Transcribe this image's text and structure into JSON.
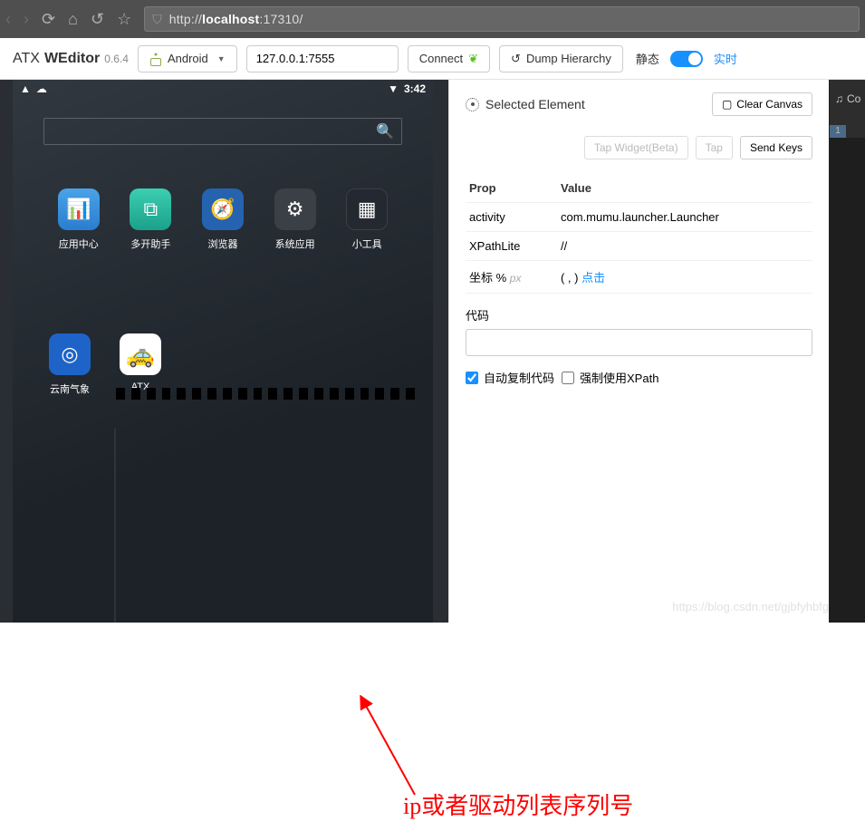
{
  "browser": {
    "url_prefix": "http://",
    "url_host": "localhost",
    "url_port": ":17310/"
  },
  "toolbar": {
    "brand_atx": "ATX",
    "brand_we": "WEditor",
    "version": "0.6.4",
    "platform_label": "Android",
    "ip_value": "127.0.0.1:7555",
    "connect_label": "Connect",
    "dump_label": "Dump Hierarchy",
    "static_label": "静态",
    "realtime_label": "实时"
  },
  "phone": {
    "time": "3:42",
    "apps_row1": [
      {
        "label": "应用中心",
        "icon": "📊",
        "cls": "ic-blue"
      },
      {
        "label": "多开助手",
        "icon": "⧉",
        "cls": "ic-teal"
      },
      {
        "label": "浏览器",
        "icon": "🧭",
        "cls": "ic-compass"
      },
      {
        "label": "系统应用",
        "icon": "⚙",
        "cls": "ic-sys"
      },
      {
        "label": "小工具",
        "icon": "▦",
        "cls": "ic-tool"
      }
    ],
    "apps_row2": [
      {
        "label": "云南气象",
        "icon": "◎",
        "cls": "ic-weather"
      },
      {
        "label": "ATX",
        "icon": "🚕",
        "cls": "ic-atx"
      }
    ]
  },
  "panel": {
    "title": "Selected Element",
    "clear_btn": "Clear Canvas",
    "tap_widget_btn": "Tap Widget(Beta)",
    "tap_btn": "Tap",
    "send_keys_btn": "Send Keys",
    "header_prop": "Prop",
    "header_value": "Value",
    "rows": [
      {
        "prop": "activity",
        "value": "com.mumu.launcher.Launcher"
      },
      {
        "prop": "XPathLite",
        "value": "//"
      }
    ],
    "coord_label": "坐标 %",
    "coord_unit": "px",
    "coord_value": "( , ) ",
    "coord_link": "点击",
    "code_label": "代码",
    "auto_copy_label": "自动复制代码",
    "force_xpath_label": "强制使用XPath"
  },
  "side": {
    "tab": "Co",
    "line": "1"
  },
  "annotation": {
    "text": "ip或者驱动列表序列号"
  },
  "watermark": "https://blog.csdn.net/gjbfyhbfg"
}
